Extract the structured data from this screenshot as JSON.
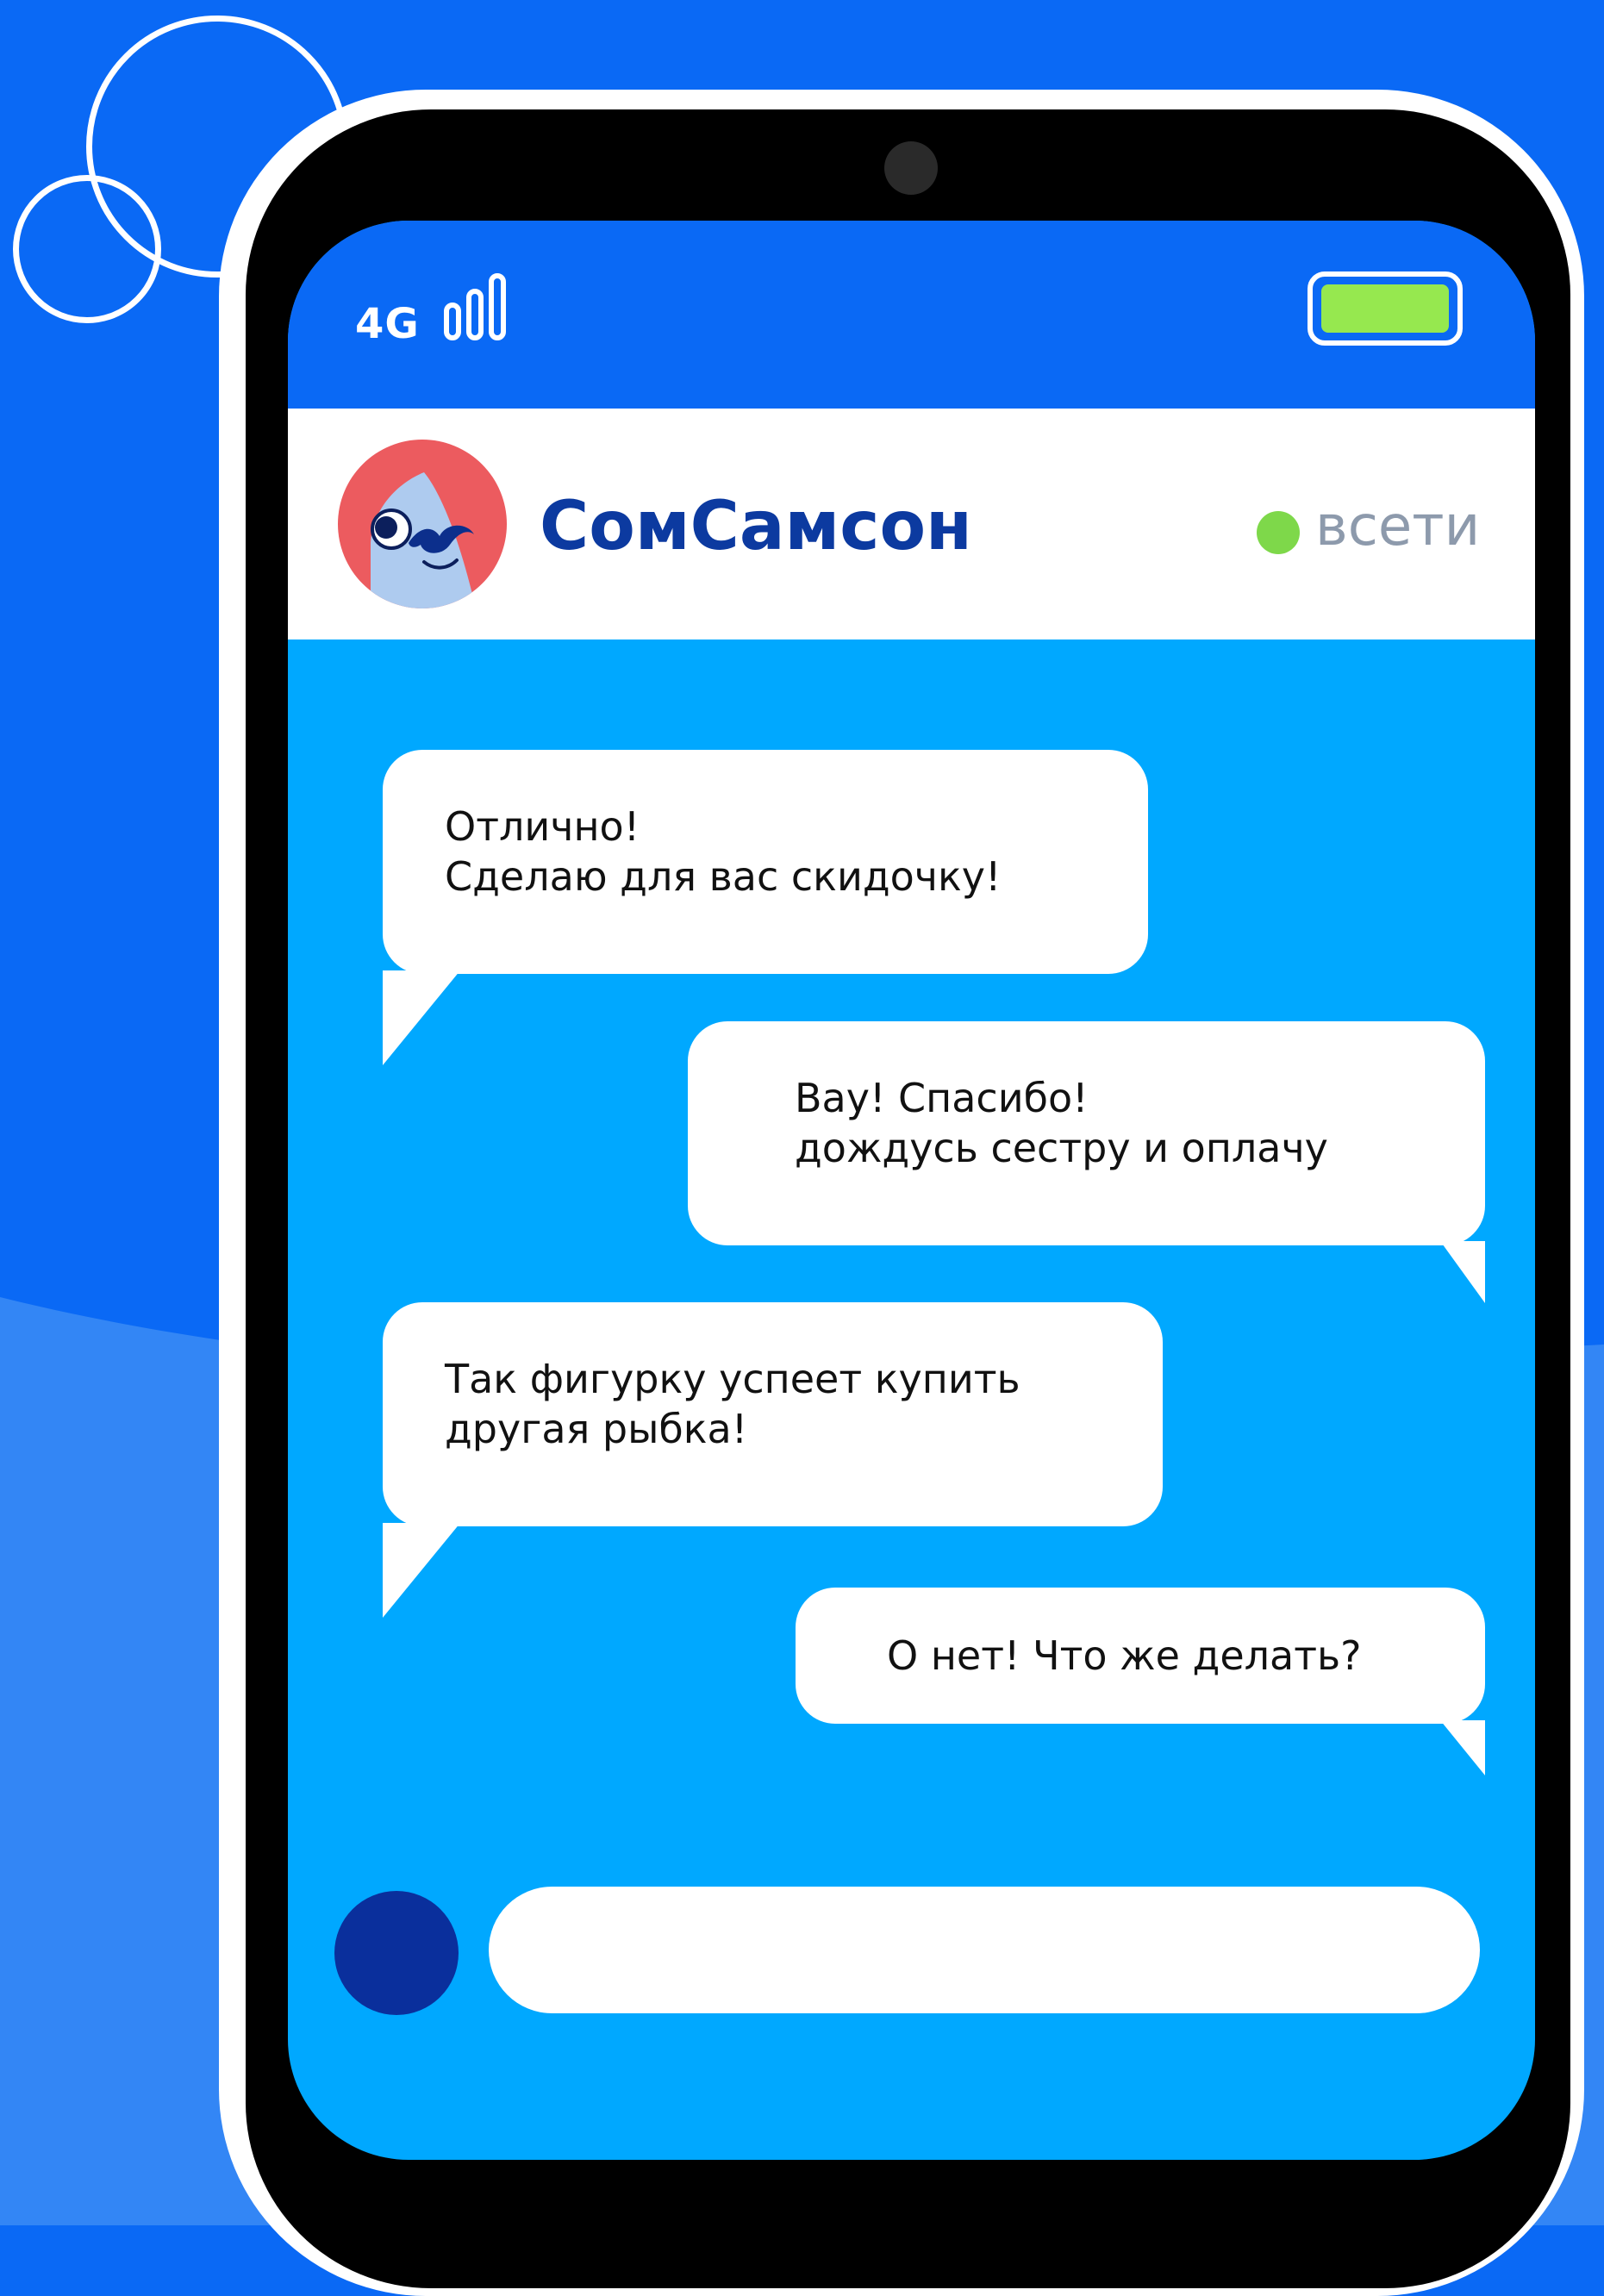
{
  "status_bar": {
    "network": "4G",
    "signal_icon": "signal-bars-icon",
    "battery_icon": "battery-icon",
    "battery_color": "#96e84f"
  },
  "header": {
    "contact_name": "СомСамсон",
    "status": "всети",
    "status_color": "#7ed84a",
    "avatar_icon": "catfish-avatar-icon"
  },
  "messages": [
    {
      "from": "contact",
      "lines": [
        "Отлично!",
        "Сделаю для вас скидочку!"
      ]
    },
    {
      "from": "me",
      "lines": [
        "Вау! Спасибо!",
        "дождусь сестру и оплачу"
      ]
    },
    {
      "from": "contact",
      "lines": [
        "Так фигурку успеет купить",
        "другая рыбка!"
      ]
    },
    {
      "from": "me",
      "lines": [
        "О нет! Что же делать?"
      ]
    }
  ],
  "composer": {
    "input_value": "",
    "placeholder": "",
    "send_button_color": "#0a2f9c"
  },
  "colors": {
    "background": "#0a69f5",
    "screen": "#00a8ff",
    "accent": "#0c3aa0"
  }
}
